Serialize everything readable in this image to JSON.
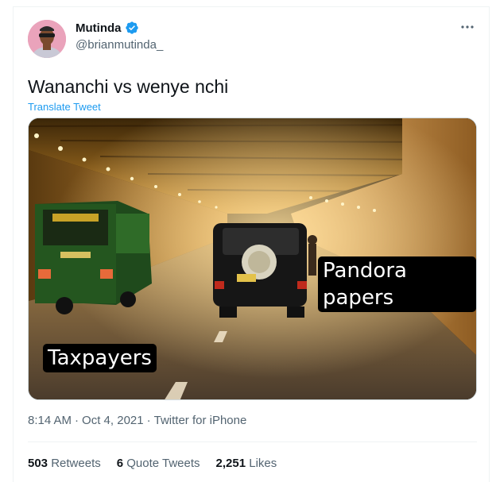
{
  "author": {
    "name": "Mutinda",
    "handle": "@brianmutinda_",
    "verified": true
  },
  "tweet": {
    "text": "Wananchi vs wenye nchi",
    "translate_label": "Translate Tweet",
    "more_icon": "more-horizontal-icon"
  },
  "media": {
    "label_left": "Taxpayers",
    "label_right": "Pandora papers"
  },
  "meta": {
    "time": "8:14 AM",
    "sep1": "·",
    "date": "Oct 4, 2021",
    "sep2": "·",
    "source": "Twitter for iPhone"
  },
  "stats": {
    "retweets_count": "503",
    "retweets_label": "Retweets",
    "quotes_count": "6",
    "quotes_label": "Quote Tweets",
    "likes_count": "2,251",
    "likes_label": "Likes"
  },
  "colors": {
    "accent": "#1d9bf0",
    "text_primary": "#0f1419",
    "text_secondary": "#536471"
  }
}
